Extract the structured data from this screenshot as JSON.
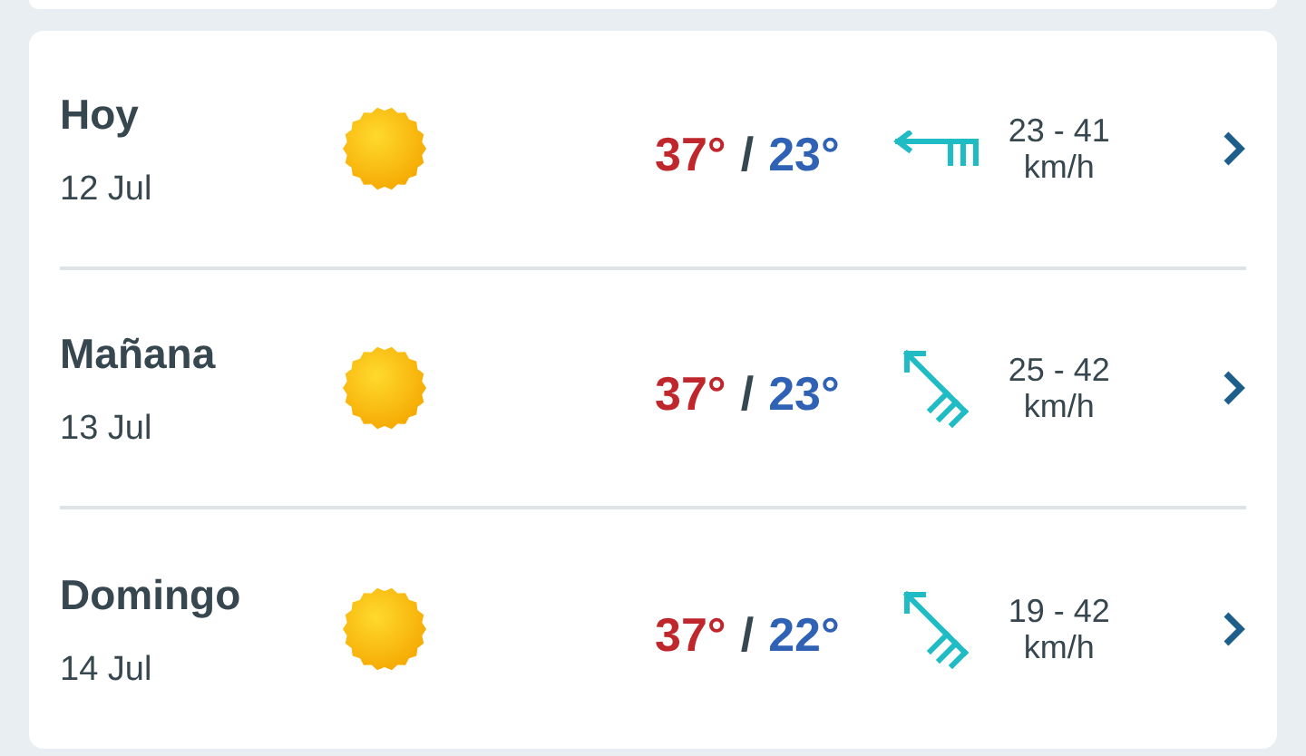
{
  "days": [
    {
      "day": "Hoy",
      "date": "12 Jul",
      "max": "37°",
      "sep": "/",
      "min": "23°",
      "kind": "west",
      "wind": "23 - 41",
      "unit": "km/h"
    },
    {
      "day": "Mañana",
      "date": "13 Jul",
      "max": "37°",
      "sep": "/",
      "min": "23°",
      "kind": "northwest",
      "wind": "25 - 42",
      "unit": "km/h"
    },
    {
      "day": "Domingo",
      "date": "14 Jul",
      "max": "37°",
      "sep": "/",
      "min": "22°",
      "kind": "northwest",
      "wind": "19 - 42",
      "unit": "km/h"
    }
  ]
}
